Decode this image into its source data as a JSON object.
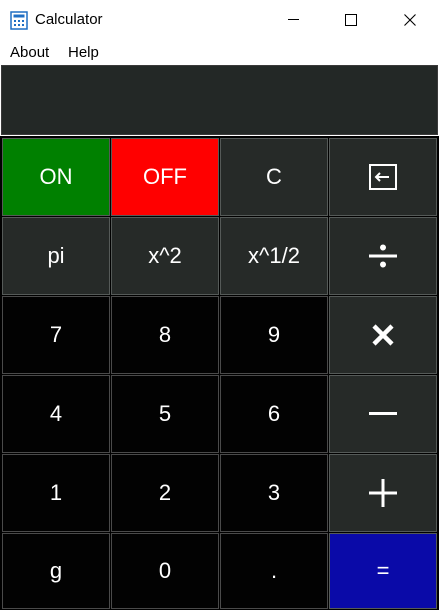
{
  "window": {
    "title": "Calculator",
    "icon": "calculator-icon",
    "controls": [
      "minimize-icon",
      "maximize-icon",
      "close-icon"
    ]
  },
  "menu": {
    "about": "About",
    "help": "Help"
  },
  "display": {
    "value": ""
  },
  "keys": {
    "on": "ON",
    "off": "OFF",
    "clear": "C",
    "backspace_icon": "backspace-icon",
    "pi": "pi",
    "square": "x^2",
    "sqrt": "x^1/2",
    "divide_icon": "divide-icon",
    "seven": "7",
    "eight": "8",
    "nine": "9",
    "multiply_icon": "multiply-icon",
    "four": "4",
    "five": "5",
    "six": "6",
    "minus_icon": "minus-icon",
    "one": "1",
    "two": "2",
    "three": "3",
    "plus_icon": "plus-icon",
    "g": "g",
    "zero": "0",
    "decimal": ".",
    "equals": "="
  },
  "colors": {
    "on": "#008000",
    "off": "#ff0000",
    "equals": "#0a0aa8",
    "display_bg": "#232826",
    "key_dark": "#262a28",
    "key_black": "#020202"
  }
}
